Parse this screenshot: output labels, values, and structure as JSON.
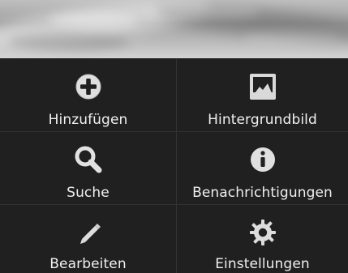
{
  "menu": {
    "items": [
      {
        "label": "Hinzufügen",
        "icon": "add-icon"
      },
      {
        "label": "Hintergrundbild",
        "icon": "wallpaper-icon"
      },
      {
        "label": "Suche",
        "icon": "search-icon"
      },
      {
        "label": "Benachrichtigungen",
        "icon": "info-icon"
      },
      {
        "label": "Bearbeiten",
        "icon": "edit-icon"
      },
      {
        "label": "Einstellungen",
        "icon": "settings-icon"
      }
    ]
  }
}
